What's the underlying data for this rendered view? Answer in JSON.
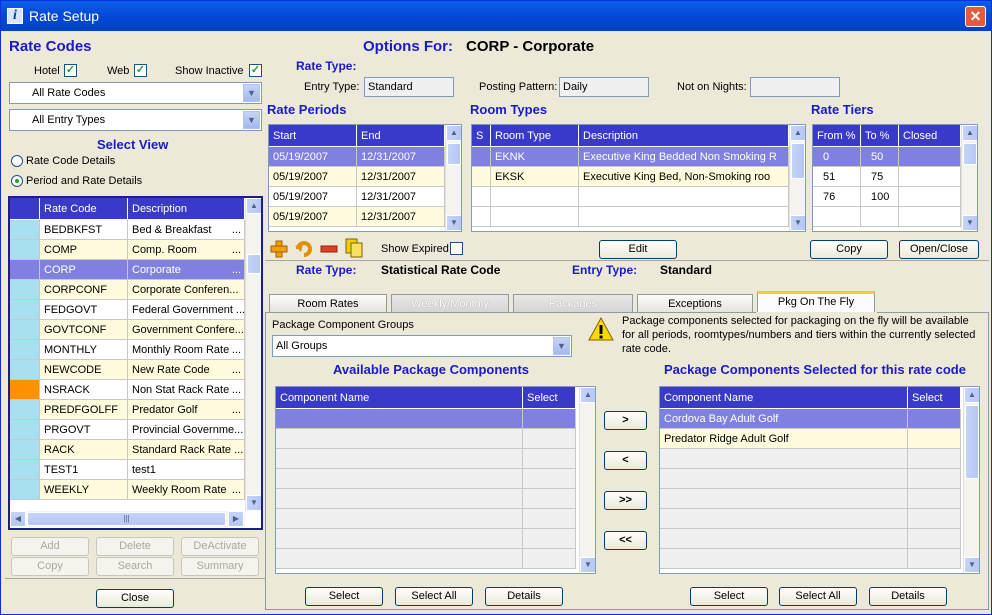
{
  "window": {
    "title": "Rate Setup"
  },
  "rate_codes": {
    "title": "Rate Codes",
    "hotel_label": "Hotel",
    "web_label": "Web",
    "show_inactive_label": "Show Inactive",
    "filter_rate_codes": "All Rate Codes",
    "filter_entry_types": "All Entry Types",
    "select_view_title": "Select View",
    "view_options": [
      "Rate Code Details",
      "Period and Rate Details"
    ],
    "columns": [
      "Rate Code",
      "Description"
    ],
    "rows": [
      {
        "code": "BEDBKFST",
        "desc": "Bed & Breakfast",
        "more": "..."
      },
      {
        "code": "COMP",
        "desc": "Comp. Room",
        "more": "..."
      },
      {
        "code": "CORP",
        "desc": "Corporate",
        "more": "..."
      },
      {
        "code": "CORPCONF",
        "desc": "Corporate Conferen...",
        "more": ""
      },
      {
        "code": "FEDGOVT",
        "desc": "Federal Government ...",
        "more": ""
      },
      {
        "code": "GOVTCONF",
        "desc": "Government Confere...",
        "more": ""
      },
      {
        "code": "MONTHLY",
        "desc": "Monthly Room Rate",
        "more": "..."
      },
      {
        "code": "NEWCODE",
        "desc": "New Rate Code",
        "more": "..."
      },
      {
        "code": "NSRACK",
        "desc": "Non Stat Rack Rate",
        "more": "..."
      },
      {
        "code": "PREDFGOLFF",
        "desc": "Predator Golf",
        "more": "..."
      },
      {
        "code": "PRGOVT",
        "desc": "Provincial Governme...",
        "more": ""
      },
      {
        "code": "RACK",
        "desc": "Standard Rack Rate ...",
        "more": ""
      },
      {
        "code": "TEST1",
        "desc": "test1",
        "more": ""
      },
      {
        "code": "WEEKLY",
        "desc": "Weekly Room Rate",
        "more": "..."
      }
    ],
    "buttons": {
      "add": "Add",
      "delete": "Delete",
      "deactivate": "DeActivate",
      "copy": "Copy",
      "search": "Search",
      "summary": "Summary",
      "close": "Close"
    }
  },
  "options": {
    "prefix": "Options For:",
    "code_name": "CORP - Corporate",
    "rate_type_label": "Rate Type:",
    "entry_type_label": "Entry Type:",
    "entry_type_value": "Standard",
    "posting_pattern_label": "Posting Pattern:",
    "posting_pattern_value": "Daily",
    "not_on_nights_label": "Not on Nights:",
    "not_on_nights_value": ""
  },
  "rate_periods": {
    "title": "Rate Periods",
    "columns": [
      "Start",
      "End"
    ],
    "rows": [
      [
        "05/19/2007",
        "12/31/2007"
      ],
      [
        "05/19/2007",
        "12/31/2007"
      ],
      [
        "05/19/2007",
        "12/31/2007"
      ],
      [
        "05/19/2007",
        "12/31/2007"
      ]
    ],
    "show_expired_label": "Show Expired"
  },
  "room_types": {
    "title": "Room Types",
    "columns": [
      "S",
      "Room Type",
      "Description"
    ],
    "rows": [
      [
        "",
        "EKNK",
        "Executive King Bedded Non Smoking R"
      ],
      [
        "",
        "EKSK",
        "Executive King Bed, Non-Smoking roo"
      ]
    ],
    "edit_label": "Edit"
  },
  "rate_tiers": {
    "title": "Rate Tiers",
    "columns": [
      "From %",
      "To %",
      "Closed"
    ],
    "rows": [
      [
        "0",
        "50",
        ""
      ],
      [
        "51",
        "75",
        ""
      ],
      [
        "76",
        "100",
        ""
      ]
    ],
    "copy_label": "Copy",
    "open_close_label": "Open/Close"
  },
  "summary": {
    "rate_type_label": "Rate Type:",
    "rate_type_value": "Statistical Rate Code",
    "entry_type_label": "Entry Type:",
    "entry_type_value": "Standard"
  },
  "tabs": [
    "Room Rates",
    "Weekly/Monthly",
    "Packages",
    "Exceptions",
    "Pkg On The Fly"
  ],
  "pkg": {
    "groups_label": "Package Component Groups",
    "groups_value": "All Groups",
    "warning_text": "Package components selected for packaging on the fly will be available for all periods, roomtypes/numbers and tiers within the currently selected rate code.",
    "available_title": "Available Package Components",
    "selected_title": "Package Components Selected for this rate code",
    "columns": [
      "Component Name",
      "Select"
    ],
    "selected_rows": [
      "Cordova Bay Adult Golf",
      "Predator Ridge Adult Golf"
    ],
    "move_buttons": [
      ">",
      "<",
      ">>",
      "<<"
    ],
    "buttons": {
      "select": "Select",
      "select_all": "Select All",
      "details": "Details"
    }
  },
  "colors": {
    "title_blue": "#1a1acc",
    "header_bg": "#3a3ac8",
    "selected": "#8080e0",
    "row_yellow": "#fffbdc"
  }
}
